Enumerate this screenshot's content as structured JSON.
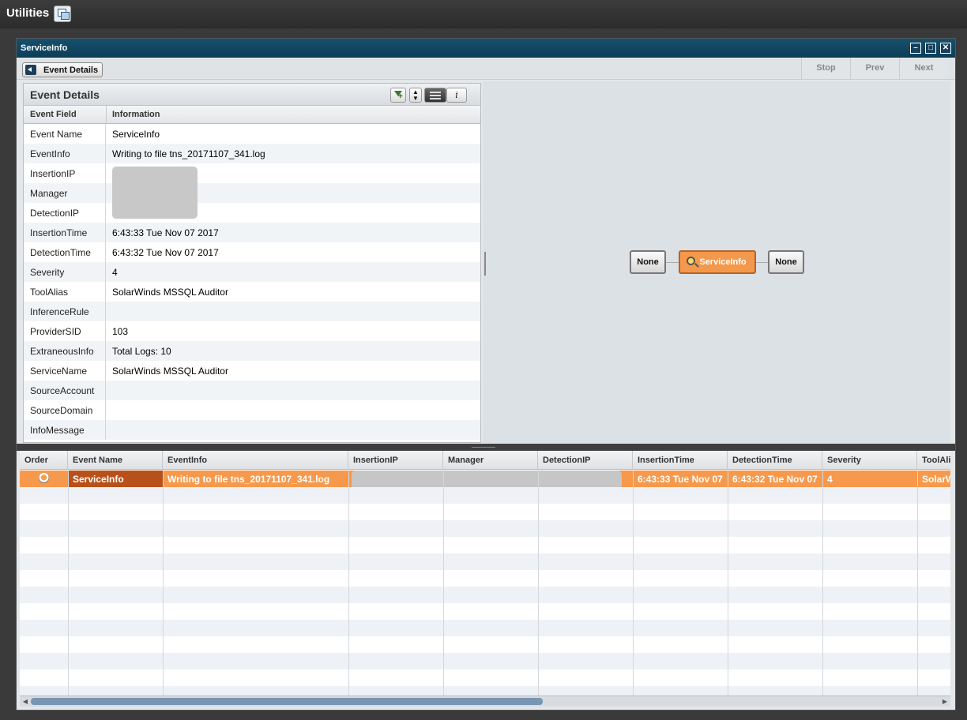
{
  "app": {
    "title": "Utilities"
  },
  "window": {
    "title": "ServiceInfo",
    "buttons": [
      "–",
      "□",
      "✕"
    ]
  },
  "toolbar": {
    "event_details_label": "Event Details",
    "stop": "Stop",
    "prev": "Prev",
    "next": "Next"
  },
  "details": {
    "title": "Event Details",
    "info_button": "i",
    "col_field": "Event Field",
    "col_info": "Information",
    "rows": [
      {
        "field": "Event Name",
        "value": "ServiceInfo"
      },
      {
        "field": "EventInfo",
        "value": "Writing to file tns_20171107_341.log"
      },
      {
        "field": "InsertionIP",
        "value": ""
      },
      {
        "field": "Manager",
        "value": ""
      },
      {
        "field": "DetectionIP",
        "value": ""
      },
      {
        "field": "InsertionTime",
        "value": "6:43:33 Tue Nov 07 2017"
      },
      {
        "field": "DetectionTime",
        "value": "6:43:32 Tue Nov 07 2017"
      },
      {
        "field": "Severity",
        "value": "4"
      },
      {
        "field": "ToolAlias",
        "value": "SolarWinds MSSQL Auditor"
      },
      {
        "field": "InferenceRule",
        "value": ""
      },
      {
        "field": "ProviderSID",
        "value": "103"
      },
      {
        "field": "ExtraneousInfo",
        "value": "Total Logs: 10"
      },
      {
        "field": "ServiceName",
        "value": "SolarWinds MSSQL Auditor"
      },
      {
        "field": "SourceAccount",
        "value": ""
      },
      {
        "field": "SourceDomain",
        "value": ""
      },
      {
        "field": "InfoMessage",
        "value": ""
      }
    ]
  },
  "graph": {
    "left": "None",
    "center": "ServiceInfo",
    "right": "None"
  },
  "grid": {
    "columns": [
      "Order",
      "Event Name",
      "EventInfo",
      "InsertionIP",
      "Manager",
      "DetectionIP",
      "InsertionTime",
      "DetectionTime",
      "Severity",
      "ToolAli"
    ],
    "selected_row": {
      "event_name": "ServiceInfo",
      "event_info": "Writing to file tns_20171107_341.log",
      "insertion_time": "6:43:33 Tue Nov 07",
      "detection_time": "6:43:32 Tue Nov 07",
      "severity": "4",
      "tool_alias": "SolarW"
    }
  },
  "colors": {
    "accent": "#f6994c",
    "title_bar": "#0c3d57",
    "selected_dark": "#b8501a"
  }
}
